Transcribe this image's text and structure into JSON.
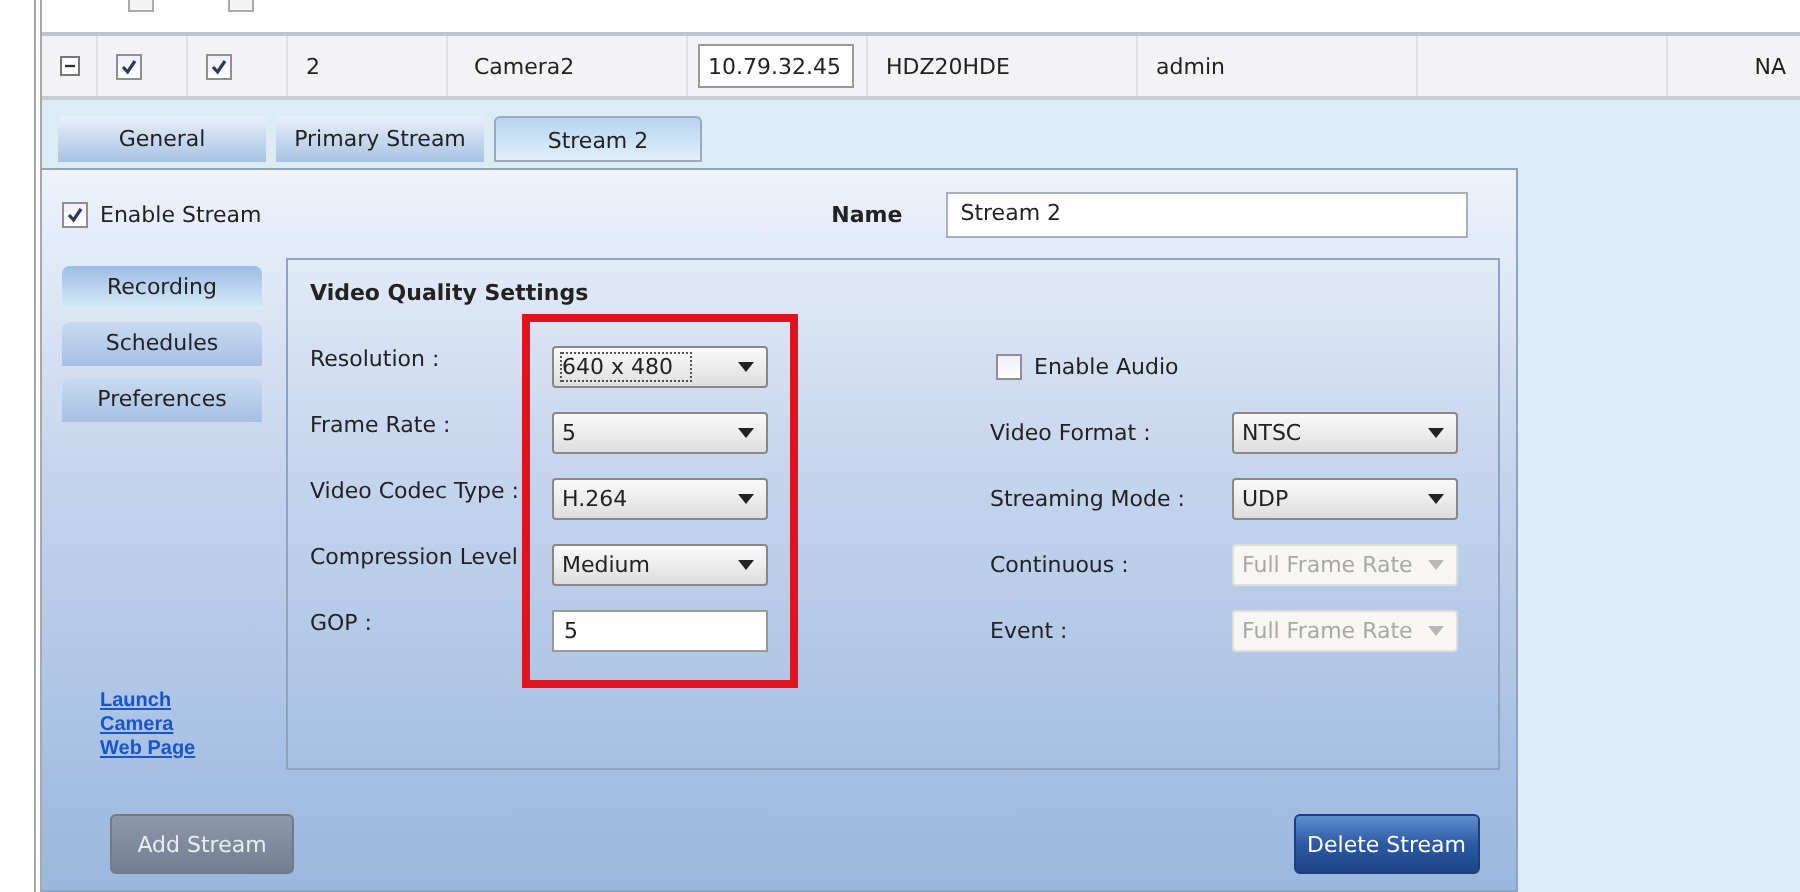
{
  "partial_row": {
    "checkboxes": [
      {
        "checked": false
      },
      {
        "checked": false
      }
    ]
  },
  "grid_row": {
    "cells": [
      {
        "kind": "expander",
        "expanded": true
      },
      {
        "kind": "checkbox",
        "checked": true
      },
      {
        "kind": "checkbox",
        "checked": true
      },
      {
        "kind": "text",
        "text": "2"
      },
      {
        "kind": "text",
        "text": "Camera2"
      },
      {
        "kind": "field",
        "text": "10.79.32.45"
      },
      {
        "kind": "text",
        "text": "HDZ20HDE"
      },
      {
        "kind": "text",
        "text": "admin"
      },
      {
        "kind": "blank"
      },
      {
        "kind": "text",
        "text": "NA"
      }
    ]
  },
  "tabs": [
    {
      "label": "General",
      "selected": false
    },
    {
      "label": "Primary Stream",
      "selected": false
    },
    {
      "label": "Stream 2",
      "selected": true
    }
  ],
  "enable_stream": {
    "label": "Enable Stream",
    "checked": true
  },
  "name_field": {
    "label": "Name",
    "value": "Stream 2"
  },
  "side_nav": [
    {
      "label": "Recording",
      "selected": true
    },
    {
      "label": "Schedules",
      "selected": false
    },
    {
      "label": "Preferences",
      "selected": false
    }
  ],
  "link": "Launch Camera Web Page",
  "settings": {
    "title": "Video Quality Settings",
    "highlighted": true,
    "left": [
      {
        "label": "Resolution :",
        "kind": "select",
        "value": "640 x 480",
        "disabled": false,
        "focused": true
      },
      {
        "label": "Frame Rate :",
        "kind": "select",
        "value": "5",
        "disabled": false,
        "focused": false
      },
      {
        "label": "Video Codec Type :",
        "kind": "select",
        "value": "H.264",
        "disabled": false,
        "focused": false
      },
      {
        "label": "Compression Level",
        "kind": "select",
        "value": "Medium",
        "disabled": false,
        "focused": false
      },
      {
        "label": "GOP :",
        "kind": "input",
        "value": "5",
        "disabled": false,
        "focused": false
      }
    ],
    "audio": {
      "label": "Enable Audio",
      "checked": false
    },
    "right": [
      {
        "label": "Video Format :",
        "kind": "select",
        "value": "NTSC",
        "disabled": false
      },
      {
        "label": "Streaming Mode :",
        "kind": "select",
        "value": "UDP",
        "disabled": false
      },
      {
        "label": "Continuous :",
        "kind": "select",
        "value": "Full Frame Rate",
        "disabled": true
      },
      {
        "label": "Event :",
        "kind": "select",
        "value": "Full Frame Rate",
        "disabled": true
      }
    ]
  },
  "add_button": {
    "label": "Add Stream",
    "disabled": true
  },
  "delete_button": {
    "label": "Delete Stream",
    "disabled": false
  }
}
